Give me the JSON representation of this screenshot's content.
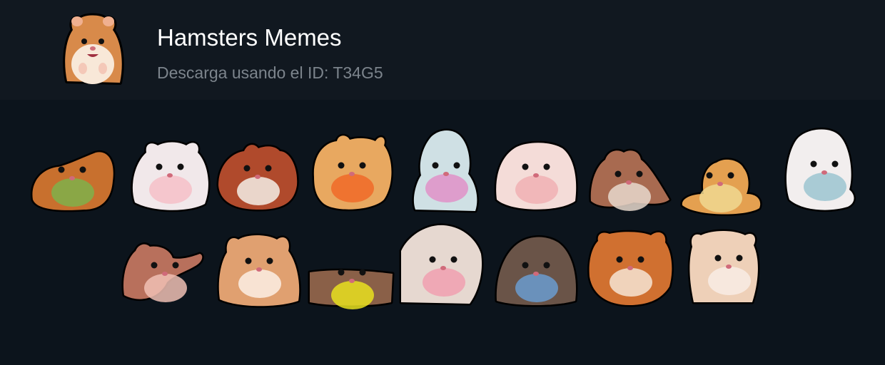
{
  "pack": {
    "title": "Hamsters Memes",
    "subtitle": "Descarga usando el ID: T34G5",
    "icon": "hamster-sticker-icon"
  },
  "colors": {
    "header_bg": "#111820",
    "page_bg": "#0c141c",
    "title": "#ffffff",
    "subtitle": "#7c848c"
  },
  "stickers": [
    {
      "name": "guinea-pig-sticker",
      "fur": "#c8702e",
      "accent": "#7fb04a"
    },
    {
      "name": "white-hamster-sticker",
      "fur": "#f1e8ea",
      "accent": "#f6c0c8"
    },
    {
      "name": "spotted-hamster-sticker",
      "fur": "#b04a2c",
      "accent": "#f4efe8"
    },
    {
      "name": "hamster-with-carrot-sticker",
      "fur": "#e8a860",
      "accent": "#f06a28"
    },
    {
      "name": "hamster-in-costume-sticker",
      "fur": "#cfe0e4",
      "accent": "#e090c8"
    },
    {
      "name": "puffy-hamster-sticker",
      "fur": "#f4dcd8",
      "accent": "#f0b0b4"
    },
    {
      "name": "hamster-with-brush-sticker",
      "fur": "#a86a50",
      "accent": "#e8d8cc"
    },
    {
      "name": "hamster-in-teacup-sticker",
      "fur": "#e4a050",
      "accent": "#f0d890"
    },
    {
      "name": "hooded-hamster-sticker",
      "fur": "#f2eeee",
      "accent": "#9cc4d0"
    },
    {
      "name": "waving-hamster-sticker",
      "fur": "#b8705c",
      "accent": "#f0c0b4"
    },
    {
      "name": "eating-hamster-sticker",
      "fur": "#e0a070",
      "accent": "#fbeee4"
    },
    {
      "name": "hamster-in-wheel-sticker",
      "fur": "#8a6048",
      "accent": "#e8e020"
    },
    {
      "name": "hamster-tongue-sticker",
      "fur": "#e6d8d0",
      "accent": "#f0a0b0"
    },
    {
      "name": "hamster-in-towel-sticker",
      "fur": "#6a5448",
      "accent": "#6a9cd0"
    },
    {
      "name": "ginger-hamster-sticker",
      "fur": "#d07030",
      "accent": "#f6e4d4"
    },
    {
      "name": "shocked-hamster-sticker",
      "fur": "#eed0b8",
      "accent": "#f8ece4"
    }
  ]
}
